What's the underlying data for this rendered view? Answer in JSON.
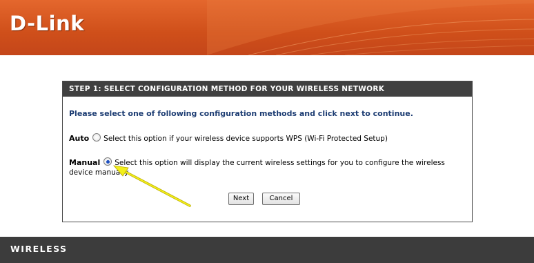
{
  "header": {
    "logo_text": "D-Link",
    "brand_color": "#d9561f"
  },
  "dialog": {
    "title": "STEP 1: SELECT CONFIGURATION METHOD FOR YOUR WIRELESS NETWORK",
    "instruction": "Please select one of following configuration methods and click next to continue.",
    "options": [
      {
        "label": "Auto",
        "description": "Select this option if your wireless device supports WPS (Wi-Fi Protected Setup)",
        "selected": false
      },
      {
        "label": "Manual",
        "description": "Select this option will display the current wireless settings for you to configure the wireless device manually",
        "selected": true
      }
    ],
    "buttons": {
      "next_label": "Next",
      "cancel_label": "Cancel"
    }
  },
  "annotation": {
    "arrow_color": "#f2ef1a",
    "icon": "arrow-pointer"
  },
  "footer": {
    "label": "WIRELESS"
  }
}
